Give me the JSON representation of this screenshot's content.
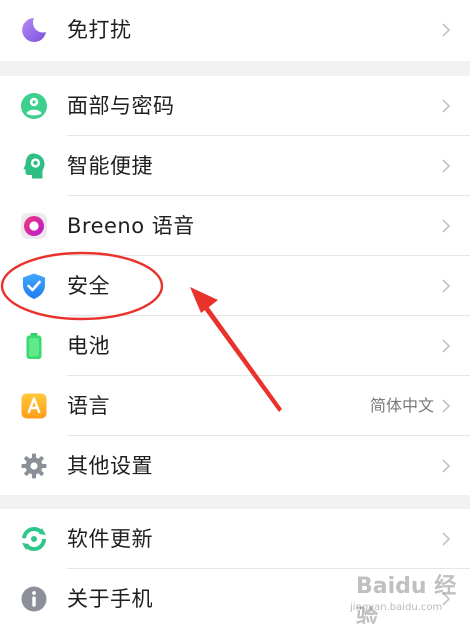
{
  "settings": {
    "top_item": {
      "label": "免打扰",
      "icon": "moon-icon"
    },
    "group2": [
      {
        "label": "面部与密码",
        "icon": "face-lock-icon"
      },
      {
        "label": "智能便捷",
        "icon": "smart-head-icon"
      },
      {
        "label": "Breeno 语音",
        "icon": "breeno-ring-icon"
      },
      {
        "label": "安全",
        "icon": "shield-check-icon"
      },
      {
        "label": "电池",
        "icon": "battery-icon"
      },
      {
        "label": "语言",
        "icon": "language-a-icon",
        "value": "简体中文"
      },
      {
        "label": "其他设置",
        "icon": "gear-icon"
      }
    ],
    "group3": [
      {
        "label": "软件更新",
        "icon": "update-icon"
      },
      {
        "label": "关于手机",
        "icon": "info-icon"
      }
    ]
  },
  "annotation": {
    "color": "#e8322b",
    "highlighted_item": "安全"
  },
  "watermark": {
    "logo_text": "Baidu 经验",
    "url": "jingyan.baidu.com"
  }
}
